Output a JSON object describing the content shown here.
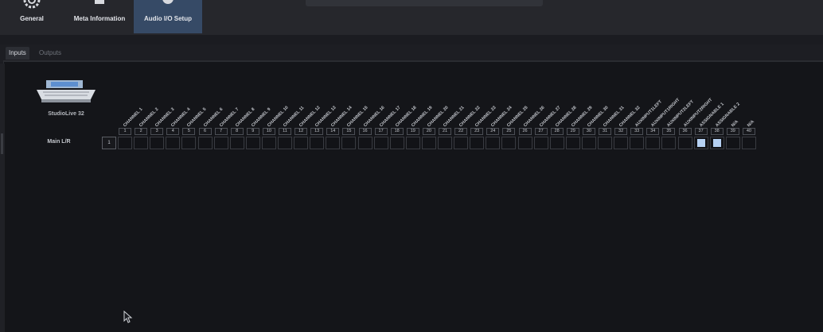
{
  "toolbar": {
    "tabs": [
      {
        "label": "General",
        "icon": "gear-icon"
      },
      {
        "label": "Meta Information",
        "icon": "document-icon"
      },
      {
        "label": "Audio I/O Setup",
        "icon": "knob-icon",
        "active": true
      }
    ]
  },
  "subtabs": [
    "Inputs",
    "Outputs"
  ],
  "matrix": {
    "device_name": "StudioLive 32",
    "row_label": "Main L/R",
    "row_number": "1",
    "columns": [
      {
        "number": "1",
        "name": "CHANNEL 1",
        "selected": false
      },
      {
        "number": "2",
        "name": "CHANNEL 2",
        "selected": false
      },
      {
        "number": "3",
        "name": "CHANNEL 3",
        "selected": false
      },
      {
        "number": "4",
        "name": "CHANNEL 4",
        "selected": false
      },
      {
        "number": "5",
        "name": "CHANNEL 5",
        "selected": false
      },
      {
        "number": "6",
        "name": "CHANNEL 6",
        "selected": false
      },
      {
        "number": "7",
        "name": "CHANNEL 7",
        "selected": false
      },
      {
        "number": "8",
        "name": "CHANNEL 8",
        "selected": false
      },
      {
        "number": "9",
        "name": "CHANNEL 9",
        "selected": false
      },
      {
        "number": "10",
        "name": "CHANNEL 10",
        "selected": false
      },
      {
        "number": "11",
        "name": "CHANNEL 11",
        "selected": false
      },
      {
        "number": "12",
        "name": "CHANNEL 12",
        "selected": false
      },
      {
        "number": "13",
        "name": "CHANNEL 13",
        "selected": false
      },
      {
        "number": "14",
        "name": "CHANNEL 14",
        "selected": false
      },
      {
        "number": "15",
        "name": "CHANNEL 15",
        "selected": false
      },
      {
        "number": "16",
        "name": "CHANNEL 16",
        "selected": false
      },
      {
        "number": "17",
        "name": "CHANNEL 17",
        "selected": false
      },
      {
        "number": "18",
        "name": "CHANNEL 18",
        "selected": false
      },
      {
        "number": "19",
        "name": "CHANNEL 19",
        "selected": false
      },
      {
        "number": "20",
        "name": "CHANNEL 20",
        "selected": false
      },
      {
        "number": "21",
        "name": "CHANNEL 21",
        "selected": false
      },
      {
        "number": "22",
        "name": "CHANNEL 22",
        "selected": false
      },
      {
        "number": "23",
        "name": "CHANNEL 23",
        "selected": false
      },
      {
        "number": "24",
        "name": "CHANNEL 24",
        "selected": false
      },
      {
        "number": "25",
        "name": "CHANNEL 25",
        "selected": false
      },
      {
        "number": "26",
        "name": "CHANNEL 26",
        "selected": false
      },
      {
        "number": "27",
        "name": "CHANNEL 27",
        "selected": false
      },
      {
        "number": "28",
        "name": "CHANNEL 28",
        "selected": false
      },
      {
        "number": "29",
        "name": "CHANNEL 29",
        "selected": false
      },
      {
        "number": "30",
        "name": "CHANNEL 30",
        "selected": false
      },
      {
        "number": "31",
        "name": "CHANNEL 31",
        "selected": false
      },
      {
        "number": "32",
        "name": "CHANNEL 32",
        "selected": false
      },
      {
        "number": "33",
        "name": "AUXINPUT1LEFT",
        "selected": false
      },
      {
        "number": "34",
        "name": "AUXINPUT1RIGHT",
        "selected": false
      },
      {
        "number": "35",
        "name": "AUXINPUT2LEFT",
        "selected": false
      },
      {
        "number": "36",
        "name": "AUXINPUT2RIGHT",
        "selected": false
      },
      {
        "number": "37",
        "name": "ASSIGNABLE 1",
        "selected": true
      },
      {
        "number": "38",
        "name": "ASSIGNABLE 2",
        "selected": true
      },
      {
        "number": "39",
        "name": "N/A",
        "selected": false
      },
      {
        "number": "40",
        "name": "N/A",
        "selected": false
      }
    ]
  }
}
